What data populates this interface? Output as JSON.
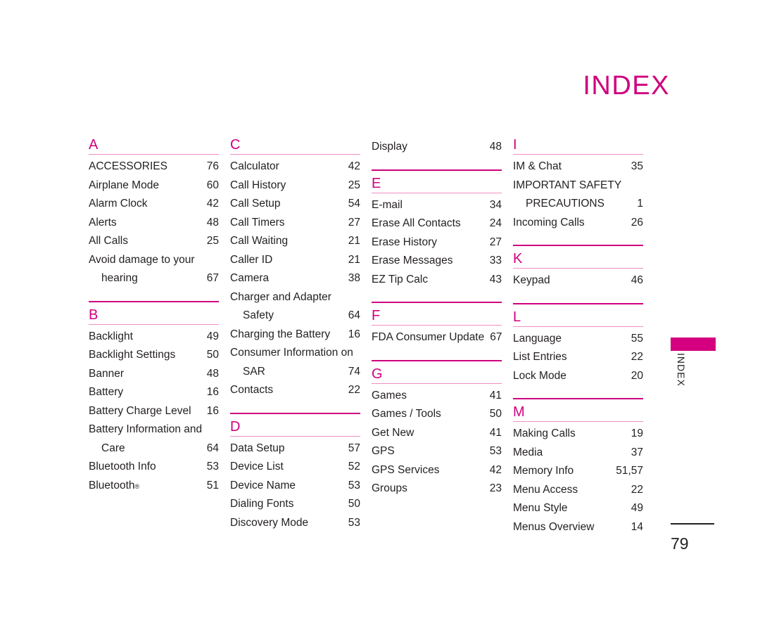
{
  "page": {
    "title": "INDEX",
    "folio": "79",
    "side_tab_label": "INDEX",
    "accent_color": "#cf007e",
    "accent_tab_color": "#d4007f",
    "rule_light_color": "#ef8fc4",
    "text_color": "#231f20"
  },
  "columns": [
    {
      "sections": [
        {
          "letter": "A",
          "has_top_rule": false,
          "entries": [
            {
              "label": "ACCESSORIES",
              "page": "76"
            },
            {
              "label": "Airplane Mode",
              "page": "60"
            },
            {
              "label": "Alarm Clock",
              "page": "42"
            },
            {
              "label": "Alerts",
              "page": "48"
            },
            {
              "label": "All Calls",
              "page": "25"
            },
            {
              "label": "Avoid damage to your",
              "cont_label": "hearing",
              "page": "67"
            }
          ]
        },
        {
          "letter": "B",
          "has_top_rule": true,
          "entries": [
            {
              "label": "Backlight",
              "page": "49"
            },
            {
              "label": "Backlight Settings",
              "page": "50"
            },
            {
              "label": "Banner",
              "page": "48"
            },
            {
              "label": "Battery",
              "page": "16"
            },
            {
              "label": "Battery Charge Level",
              "page": "16"
            },
            {
              "label": "Battery Information and",
              "cont_label": "Care",
              "page": "64"
            },
            {
              "label": "Bluetooth Info",
              "page": "53"
            },
            {
              "label": "Bluetooth",
              "registered": true,
              "page": "51"
            }
          ]
        }
      ]
    },
    {
      "sections": [
        {
          "letter": "C",
          "has_top_rule": false,
          "entries": [
            {
              "label": "Calculator",
              "page": "42"
            },
            {
              "label": "Call History",
              "page": "25"
            },
            {
              "label": "Call Setup",
              "page": "54"
            },
            {
              "label": "Call Timers",
              "page": "27"
            },
            {
              "label": "Call Waiting",
              "page": "21"
            },
            {
              "label": "Caller ID",
              "page": "21"
            },
            {
              "label": "Camera",
              "page": "38"
            },
            {
              "label": "Charger and Adapter",
              "cont_label": "Safety",
              "page": "64"
            },
            {
              "label": "Charging the Battery",
              "page": "16"
            },
            {
              "label": "Consumer Information on",
              "cont_label": "SAR",
              "page": "74"
            },
            {
              "label": "Contacts",
              "page": "22"
            }
          ]
        },
        {
          "letter": "D",
          "has_top_rule": true,
          "entries": [
            {
              "label": "Data Setup",
              "page": "57"
            },
            {
              "label": "Device List",
              "page": "52"
            },
            {
              "label": "Device Name",
              "page": "53"
            },
            {
              "label": "Dialing Fonts",
              "page": "50"
            },
            {
              "label": "Discovery Mode",
              "page": "53"
            }
          ]
        }
      ]
    },
    {
      "sections": [
        {
          "letter": null,
          "has_top_rule": false,
          "entries": [
            {
              "label": "Display",
              "page": "48"
            }
          ]
        },
        {
          "letter": "E",
          "has_top_rule": true,
          "entries": [
            {
              "label": "E-mail",
              "page": "34"
            },
            {
              "label": "Erase All Contacts",
              "page": "24"
            },
            {
              "label": "Erase History",
              "page": "27"
            },
            {
              "label": "Erase Messages",
              "page": "33"
            },
            {
              "label": "EZ Tip Calc",
              "page": "43"
            }
          ]
        },
        {
          "letter": "F",
          "has_top_rule": true,
          "entries": [
            {
              "label": "FDA Consumer Update",
              "page": "67"
            }
          ]
        },
        {
          "letter": "G",
          "has_top_rule": true,
          "entries": [
            {
              "label": "Games",
              "page": "41"
            },
            {
              "label": "Games / Tools",
              "page": "50"
            },
            {
              "label": "Get New",
              "page": "41"
            },
            {
              "label": "GPS",
              "page": "53"
            },
            {
              "label": "GPS Services",
              "page": "42"
            },
            {
              "label": "Groups",
              "page": "23"
            }
          ]
        }
      ]
    },
    {
      "sections": [
        {
          "letter": "I",
          "has_top_rule": false,
          "entries": [
            {
              "label": "IM & Chat",
              "page": "35"
            },
            {
              "label": "IMPORTANT SAFETY",
              "cont_label": "PRECAUTIONS",
              "page": "1"
            },
            {
              "label": "Incoming Calls",
              "page": "26"
            }
          ]
        },
        {
          "letter": "K",
          "has_top_rule": true,
          "entries": [
            {
              "label": "Keypad",
              "page": "46"
            }
          ]
        },
        {
          "letter": "L",
          "has_top_rule": true,
          "entries": [
            {
              "label": "Language",
              "page": "55"
            },
            {
              "label": "List Entries",
              "page": "22"
            },
            {
              "label": "Lock Mode",
              "page": "20"
            }
          ]
        },
        {
          "letter": "M",
          "has_top_rule": true,
          "entries": [
            {
              "label": "Making Calls",
              "page": "19"
            },
            {
              "label": "Media",
              "page": "37"
            },
            {
              "label": "Memory Info",
              "page": "51,57"
            },
            {
              "label": "Menu Access",
              "page": "22"
            },
            {
              "label": "Menu Style",
              "page": "49"
            },
            {
              "label": "Menus Overview",
              "page": "14"
            }
          ]
        }
      ]
    }
  ]
}
